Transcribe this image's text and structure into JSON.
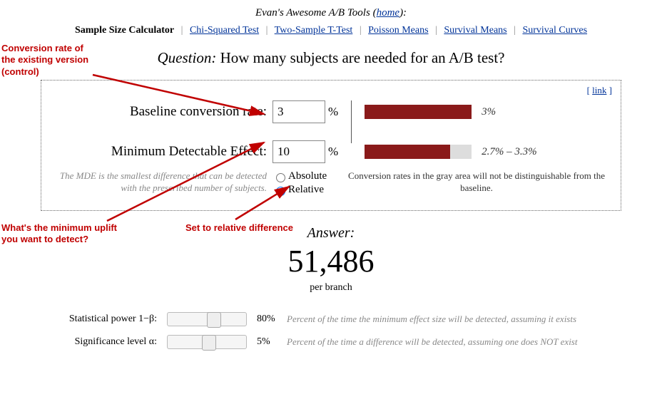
{
  "header": {
    "site_title": "Evan's Awesome A/B Tools",
    "home_label": "home"
  },
  "nav": {
    "current": "Sample Size Calculator",
    "items": [
      "Chi-Squared Test",
      "Two-Sample T-Test",
      "Poisson Means",
      "Survival Means",
      "Survival Curves"
    ]
  },
  "question": {
    "label": "Question:",
    "text": "How many subjects are needed for an A/B test?"
  },
  "link_label": "link",
  "fields": {
    "baseline_label": "Baseline conversion rate:",
    "baseline_value": "3",
    "baseline_bar_label": "3%",
    "mde_label": "Minimum Detectable Effect:",
    "mde_value": "10",
    "mde_bar_label": "2.7% – 3.3%",
    "pct_sign": "%",
    "mde_note": "The MDE is the smallest difference that can be detected with the prescribed number of subjects.",
    "absolute_label": "Absolute",
    "relative_label": "Relative",
    "gray_note": "Conversion rates in the gray area will not be distinguishable from the baseline."
  },
  "answer": {
    "label": "Answer:",
    "value": "51,486",
    "sub": "per branch"
  },
  "sliders": {
    "power_label": "Statistical power 1−β:",
    "power_value": "80%",
    "power_desc": "Percent of the time the minimum effect size will be detected, assuming it exists",
    "alpha_label": "Significance level α:",
    "alpha_value": "5%",
    "alpha_desc": "Percent of the time a difference will be detected, assuming one does NOT exist"
  },
  "annotations": {
    "a1": "Conversion rate of\nthe existing version\n(control)",
    "a2": "What's the minimum uplift\nyou want to detect?",
    "a3": "Set to relative difference"
  }
}
